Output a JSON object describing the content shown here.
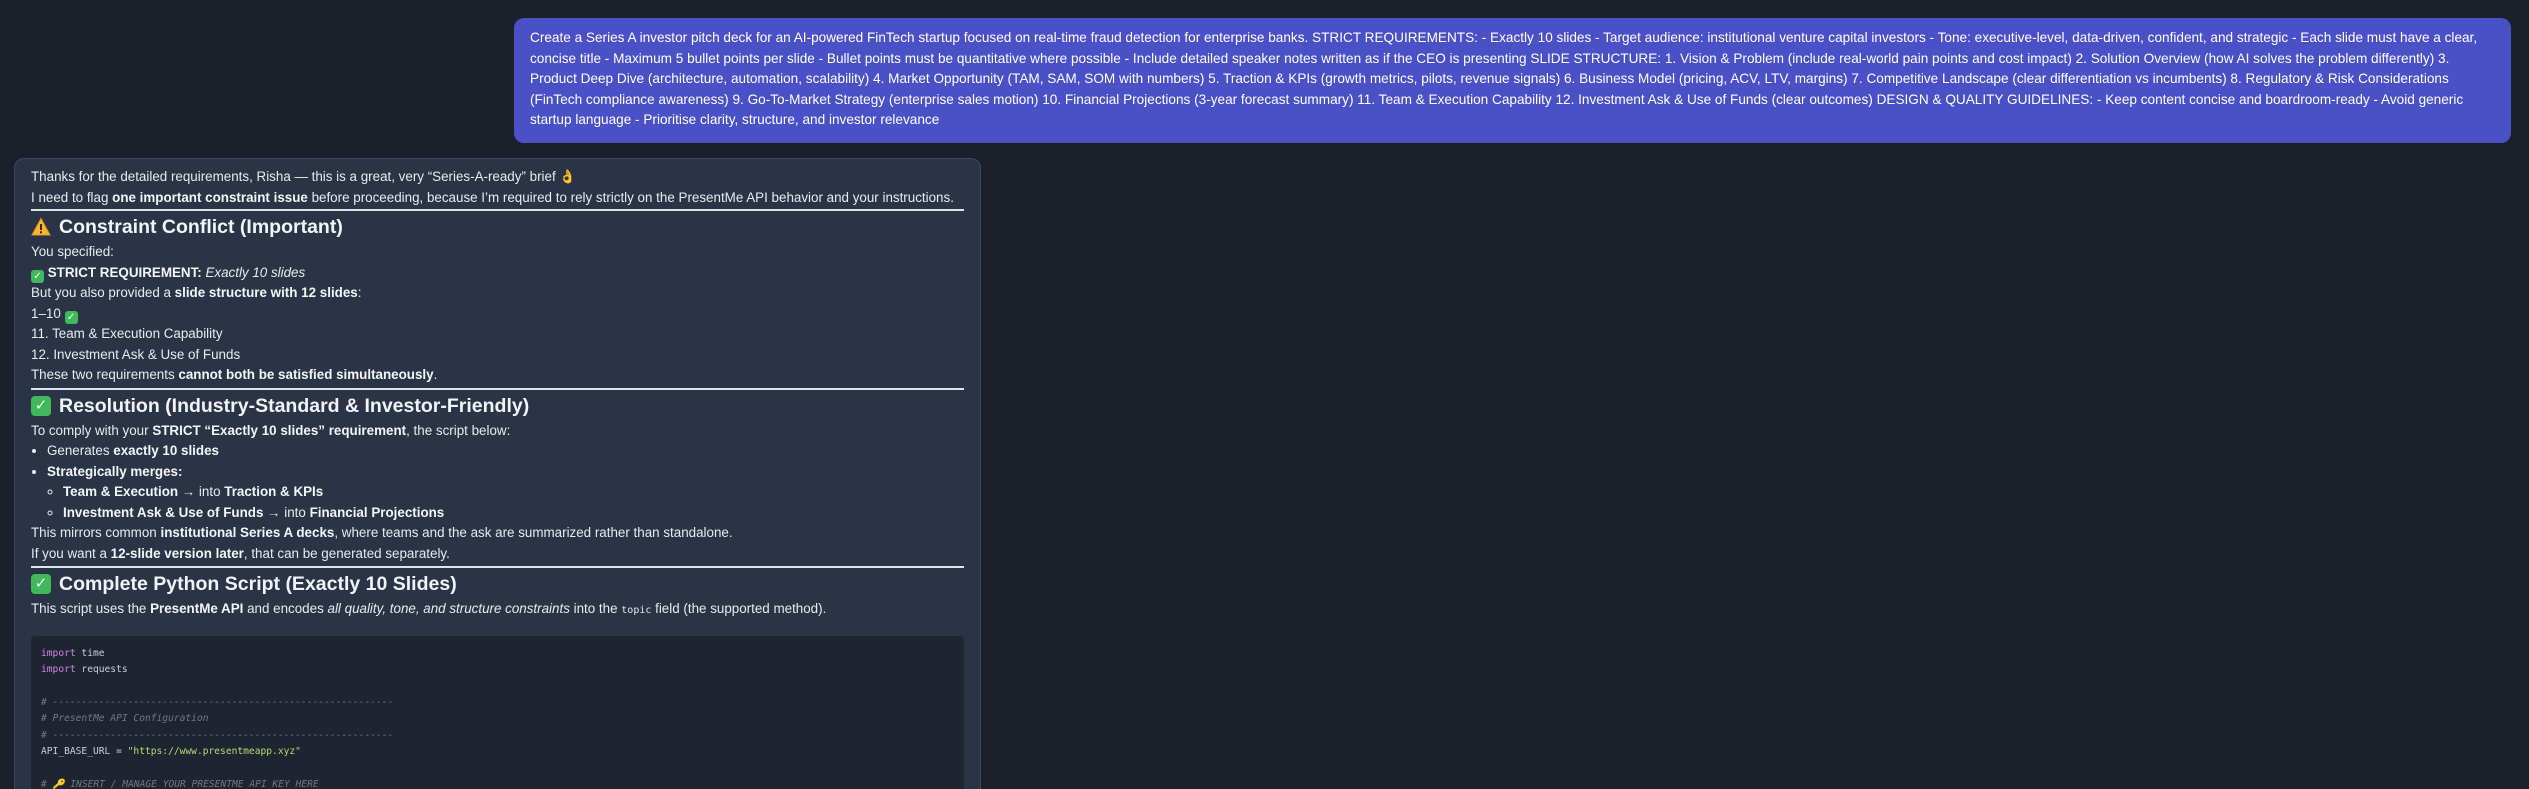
{
  "user_message": {
    "text": "Create a Series A investor pitch deck for an AI-powered FinTech startup focused on real-time fraud detection for enterprise banks. STRICT REQUIREMENTS: - Exactly 10 slides - Target audience: institutional venture capital investors - Tone: executive-level, data-driven, confident, and strategic - Each slide must have a clear, concise title - Maximum 5 bullet points per slide - Bullet points must be quantitative where possible - Include detailed speaker notes written as if the CEO is presenting SLIDE STRUCTURE: 1. Vision & Problem (include real-world pain points and cost impact) 2. Solution Overview (how AI solves the problem differently) 3. Product Deep Dive (architecture, automation, scalability) 4. Market Opportunity (TAM, SAM, SOM with numbers) 5. Traction & KPIs (growth metrics, pilots, revenue signals) 6. Business Model (pricing, ACV, LTV, margins) 7. Competitive Landscape (clear differentiation vs incumbents) 8. Regulatory & Risk Considerations (FinTech compliance awareness) 9. Go-To-Market Strategy (enterprise sales motion) 10. Financial Projections (3-year forecast summary) 11. Team & Execution Capability 12. Investment Ask & Use of Funds (clear outcomes) DESIGN & QUALITY GUIDELINES: - Keep content concise and boardroom-ready - Avoid generic startup language - Prioritise clarity, structure, and investor relevance"
  },
  "assistant": {
    "intro_line1": "Thanks for the detailed requirements, Risha — this is a great, very “Series-A-ready” brief 👌",
    "intro_line2_a": "I need to flag ",
    "intro_line2_b": "one important constraint issue",
    "intro_line2_c": " before proceeding, because I’m required to rely strictly on the PresentMe API behavior and your instructions.",
    "section1": {
      "icon": "warning-icon",
      "title": "Constraint Conflict (Important)",
      "you_specified": "You specified:",
      "strict_label": "STRICT REQUIREMENT:",
      "strict_value": "Exactly 10 slides",
      "but_a": "But you also provided a ",
      "but_b": "slide structure with 12 slides",
      "but_c": ":",
      "range": "1–10",
      "item11": "11. Team & Execution Capability",
      "item12": "12. Investment Ask & Use of Funds",
      "conclusion_a": "These two requirements ",
      "conclusion_b": "cannot both be satisfied simultaneously",
      "conclusion_c": "."
    },
    "section2": {
      "icon": "check-icon",
      "title": "Resolution (Industry-Standard & Investor-Friendly)",
      "comply_a": "To comply with your ",
      "comply_b": "STRICT “Exactly 10 slides” requirement",
      "comply_c": ", the script below:",
      "bullet1_a": "Generates ",
      "bullet1_b": "exactly 10 slides",
      "bullet2": "Strategically merges:",
      "merge1_a": "Team & Execution",
      "merge1_b": " → into ",
      "merge1_c": "Traction & KPIs",
      "merge2_a": "Investment Ask & Use of Funds",
      "merge2_b": " → into ",
      "merge2_c": "Financial Projections",
      "mirror_a": "This mirrors common ",
      "mirror_b": "institutional Series A decks",
      "mirror_c": ", where teams and the ask are summarized rather than standalone.",
      "later_a": "If you want a ",
      "later_b": "12-slide version later",
      "later_c": ", that can be generated separately."
    },
    "section3": {
      "icon": "check-icon",
      "title": "Complete Python Script (Exactly 10 Slides)",
      "desc_a": "This script uses the ",
      "desc_b": "PresentMe API",
      "desc_c": " and encodes ",
      "desc_d": "all quality, tone, and structure constraints",
      "desc_e": " into the ",
      "desc_f": "topic",
      "desc_g": " field (the supported method)."
    },
    "code": {
      "line1_kw": "import",
      "line1_rest": " time",
      "line2_kw": "import",
      "line2_rest": " requests",
      "sep1": "# -----------------------------------------------------------",
      "cfg": "# PresentMe API Configuration",
      "sep2": "# -----------------------------------------------------------",
      "url_var": "API_BASE_URL = ",
      "url_val": "\"https://www.presentmeapp.xyz\"",
      "key_comment": "# 🔑 INSERT / MANAGE YOUR PRESENTME API KEY HERE"
    }
  },
  "colors": {
    "background": "#1b202a",
    "user_bubble": "#4a51c6",
    "assistant_card": "#2b3446",
    "check_green": "#3fb95a",
    "warning_amber": "#f5b82e"
  }
}
